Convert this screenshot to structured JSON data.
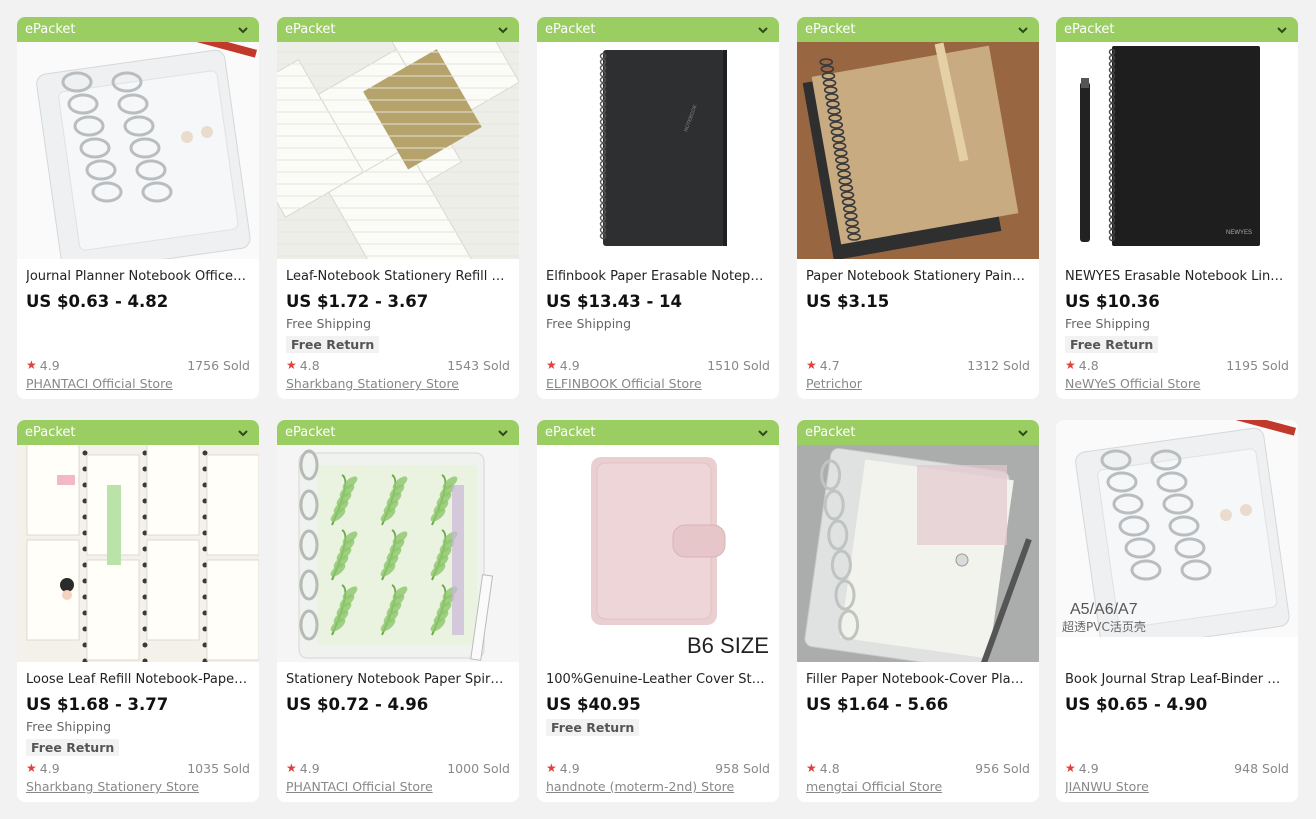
{
  "colors": {
    "ship_bar": "#9acd62",
    "star": "#e2403a",
    "page_bg": "#f2f2f2"
  },
  "products": [
    {
      "badge": "ePacket",
      "title": "Journal Planner Notebook Office-S...",
      "price": "US $0.63 - 4.82",
      "shipping": "",
      "return_label": "",
      "rating": "4.9",
      "sold": "1756 Sold",
      "store": "PHANTACI Official Store",
      "image_icon": "clear-binder-photo"
    },
    {
      "badge": "ePacket",
      "title": "Leaf-Notebook Stationery Refill Pa...",
      "price": "US $1.72 - 3.67",
      "shipping": "Free Shipping",
      "return_label": "Free Return",
      "rating": "4.8",
      "sold": "1543 Sold",
      "store": "Sharkbang Stationery Store",
      "image_icon": "refill-paper-photo"
    },
    {
      "badge": "ePacket",
      "title": "Elfinbook Paper Erasable Notepad ...",
      "price": "US $13.43 - 14",
      "shipping": "Free Shipping",
      "return_label": "",
      "rating": "4.9",
      "sold": "1510 Sold",
      "store": "ELFINBOOK Official Store",
      "image_icon": "black-spiral-notebook-photo"
    },
    {
      "badge": "ePacket",
      "title": "Paper Notebook Stationery Paintin...",
      "price": "US $3.15",
      "shipping": "",
      "return_label": "",
      "rating": "4.7",
      "sold": "1312 Sold",
      "store": "Petrichor",
      "image_icon": "kraft-sketchbook-photo"
    },
    {
      "badge": "ePacket",
      "title": "NEWYES Erasable Notebook Lined ...",
      "price": "US $10.36",
      "shipping": "Free Shipping",
      "return_label": "Free Return",
      "rating": "4.8",
      "sold": "1195 Sold",
      "store": "NeWYeS Official Store",
      "image_icon": "black-notebook-pen-photo"
    },
    {
      "badge": "ePacket",
      "title": "Loose Leaf Refill Notebook-Paper ...",
      "price": "US $1.68 - 3.77",
      "shipping": "Free Shipping",
      "return_label": "Free Return",
      "rating": "4.9",
      "sold": "1035 Sold",
      "store": "Sharkbang Stationery Store",
      "image_icon": "planner-pages-photo"
    },
    {
      "badge": "ePacket",
      "title": "Stationery Notebook Paper Spiral-...",
      "price": "US $0.72 - 4.96",
      "shipping": "",
      "return_label": "",
      "rating": "4.9",
      "sold": "1000 Sold",
      "store": "PHANTACI Official Store",
      "image_icon": "leaf-binder-photo"
    },
    {
      "badge": "ePacket",
      "title": "100%Genuine-Leather Cover Stati...",
      "price": "US $40.95",
      "shipping": "",
      "return_label": "Free Return",
      "rating": "4.9",
      "sold": "958 Sold",
      "store": "handnote (moterm-2nd) Store",
      "image_icon": "pink-leather-notebook-photo",
      "image_text": "B6 SIZE"
    },
    {
      "badge": "ePacket",
      "title": "Filler Paper Notebook-Cover Plann...",
      "price": "US $1.64 - 5.66",
      "shipping": "",
      "return_label": "",
      "rating": "4.8",
      "sold": "956 Sold",
      "store": "mengtai Official Store",
      "image_icon": "ring-binder-flowers-photo"
    },
    {
      "badge": "",
      "title": "Book Journal Strap Leaf-Binder A5 ...",
      "price": "US $0.65 - 4.90",
      "shipping": "",
      "return_label": "",
      "rating": "4.9",
      "sold": "948 Sold",
      "store": "JIANWU Store",
      "image_icon": "clear-binder-sizes-photo",
      "image_text": "A5/A6/A7",
      "image_subtext": "超透PVC活页壳"
    }
  ]
}
